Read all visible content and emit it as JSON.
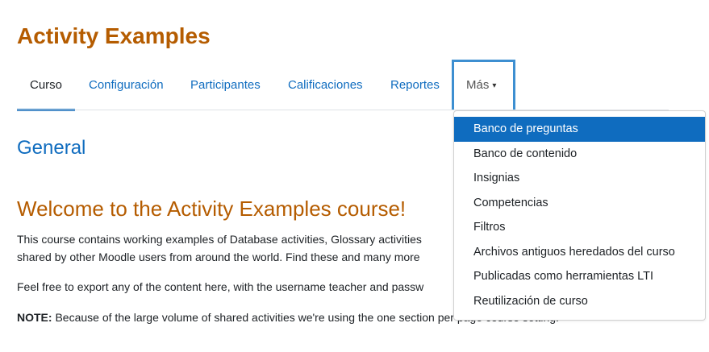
{
  "course": {
    "title": "Activity Examples"
  },
  "nav": {
    "items": [
      "Curso",
      "Configuración",
      "Participantes",
      "Calificaciones",
      "Reportes"
    ],
    "more_label": "Más"
  },
  "dropdown": {
    "items": [
      "Banco de preguntas",
      "Banco de contenido",
      "Insignias",
      "Competencias",
      "Filtros",
      "Archivos antiguos heredados del curso",
      "Publicadas como herramientas LTI",
      "Reutilización de curso"
    ]
  },
  "content": {
    "section_title": "General",
    "welcome_heading": "Welcome to the Activity Examples course!",
    "p1_line1": "This course contains working examples of Database activities, Glossary activities",
    "p1_line2": "shared by other Moodle users from around the world. Find these and many more",
    "p2": "Feel free to export any of the content here, with the username teacher and passw",
    "note_label": "NOTE:",
    "p3": " Because of the large volume of shared activities we're using the one section per page course setting."
  },
  "colors": {
    "brand": "#b55c00",
    "link": "#0f6cbf",
    "focus": "#3d8fd1"
  }
}
